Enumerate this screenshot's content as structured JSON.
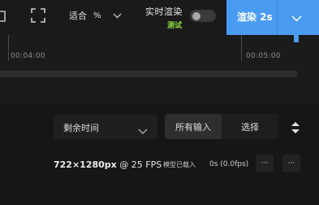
{
  "toolbar": {
    "fit_label": "适合",
    "fit_unit": "%",
    "realtime_label": "实时渲染",
    "realtime_sub": "测试",
    "realtime_enabled": false,
    "render_label": "渲染 2s",
    "accent_color": "#4a9cf3"
  },
  "timeline": {
    "times": [
      "00:04:00",
      "00:05:00"
    ]
  },
  "controls": {
    "select_value": "剩余时间",
    "segments": [
      "所有输入",
      "选择"
    ],
    "active_segment": "所有输入"
  },
  "row": {
    "resolution": "722×1280px",
    "fps_text": "@ 25 FPS",
    "status": "模型已载入",
    "timing": "0s (0.0fps)",
    "more_label_1": "···",
    "more_label_2": "···"
  },
  "icons": {
    "left_clipped": "panel-icon",
    "fullscreen": "fullscreen-icon",
    "fit_dropdown": "chevron-down-icon",
    "render_dropdown": "chevron-down-icon",
    "select_dropdown": "chevron-down-icon",
    "sort": "sort-icon"
  }
}
